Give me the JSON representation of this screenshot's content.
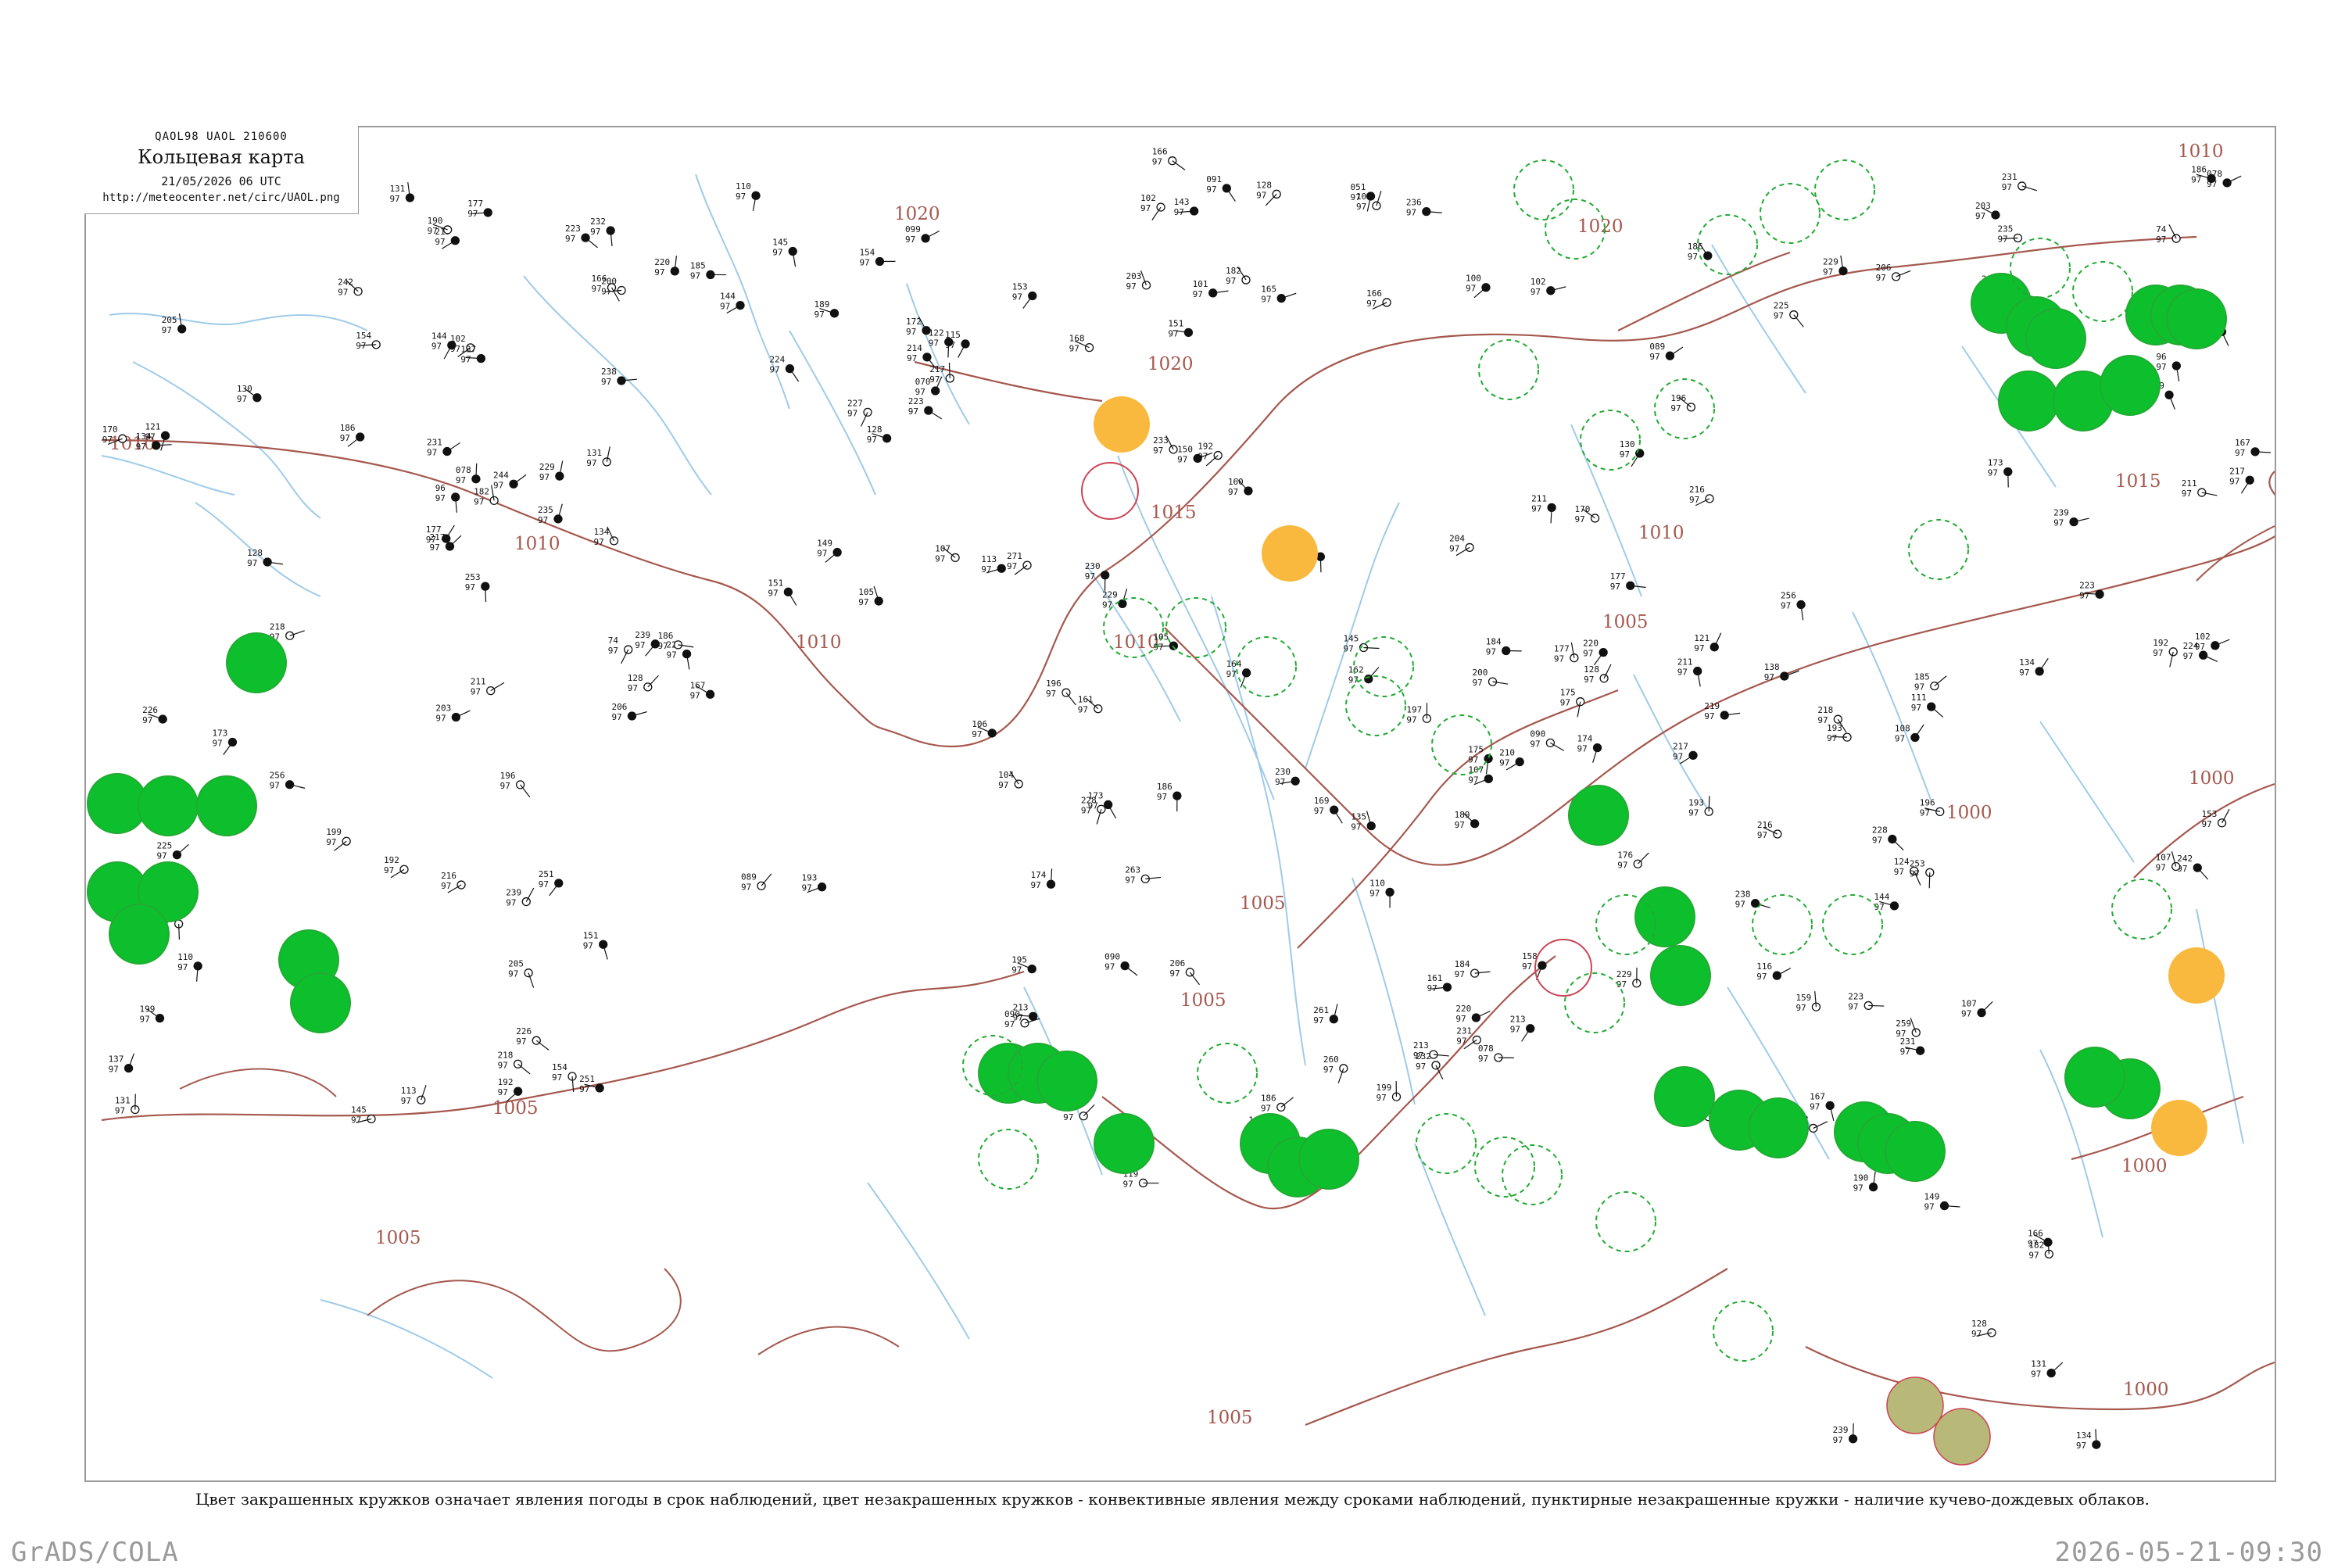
{
  "header": {
    "codes": "QAOL98  UAOL  210600",
    "title": "Кольцевая карта",
    "time": "21/05/2026 06 UTC",
    "url": "http://meteocenter.net/circ/UAOL.png"
  },
  "caption": "Цвет закрашенных кружков означает явления погоды в срок наблюдений, цвет незакрашенных кружков - конвективные явления между сроками наблюдений, пунктирные незакрашенные кружки - наличие кучево-дождевых облаков.",
  "footer": {
    "credit": "GrADS/COLA",
    "timestamp": "2026-05-21-09:30"
  },
  "colors": {
    "isobar": "#a5584e",
    "river": "#9ecbe8",
    "shower_green": "#0dbf2c",
    "thunder_outline": "#22aa33",
    "haze_orange": "#f8b93e",
    "dust_olive": "#b8b878",
    "frame": "#9a9a9a"
  },
  "isobar_labels": [
    "1010",
    "1010",
    "1010",
    "1015",
    "1015",
    "1020",
    "1020",
    "1020",
    "1010",
    "1005",
    "1010",
    "1005",
    "1005",
    "1005",
    "1005",
    "1000",
    "1000",
    "1000",
    "1000",
    "1005"
  ],
  "station_numbers": [
    "253",
    "217",
    "229",
    "232",
    "200",
    "193",
    "189",
    "238",
    "144",
    "173",
    "225",
    "102",
    "229",
    "219",
    "74",
    "177",
    "96",
    "220",
    "089",
    "186",
    "186",
    "206",
    "170",
    "211",
    "235",
    "224",
    "128",
    "256",
    "196",
    "177",
    "121",
    "185",
    "223",
    "078",
    "203",
    "239",
    "211",
    "130",
    "231",
    "244",
    "134",
    "216",
    "211",
    "239",
    "190",
    "131",
    "182",
    "134",
    "166",
    "128",
    "149",
    "113",
    "199",
    "144",
    "151",
    "137",
    "226",
    "145",
    "131",
    "110",
    "154",
    "218",
    "192",
    "205",
    "251",
    "242",
    "167",
    "107",
    "168",
    "217",
    "192",
    "099",
    "162",
    "102",
    "153",
    "161",
    "091",
    "151",
    "182",
    "143",
    "166",
    "172",
    "184",
    "197",
    "164",
    "128",
    "196",
    "178",
    "122",
    "150",
    "214",
    "115",
    "070",
    "233",
    "230",
    "166",
    "105",
    "203",
    "113",
    "051",
    "227",
    "128",
    "105",
    "109",
    "100",
    "204",
    "229",
    "160",
    "223",
    "101",
    "165",
    "271",
    "236",
    "145",
    "154",
    "106",
    "230",
    "195",
    "260",
    "213",
    "174",
    "186",
    "228",
    "110",
    "119",
    "263",
    "135",
    "168",
    "199",
    "261",
    "107",
    "186",
    "173",
    "090",
    "169",
    "213",
    "090",
    "206",
    "161",
    "104",
    "225",
    "229",
    "107",
    "223",
    "184",
    "175",
    "167",
    "108",
    "231",
    "218",
    "078",
    "158",
    "183",
    "228",
    "175",
    "138",
    "176",
    "090",
    "111",
    "116",
    "210",
    "259",
    "220",
    "122",
    "213",
    "216",
    "174",
    "159",
    "193",
    "124",
    "196",
    "231"
  ]
}
